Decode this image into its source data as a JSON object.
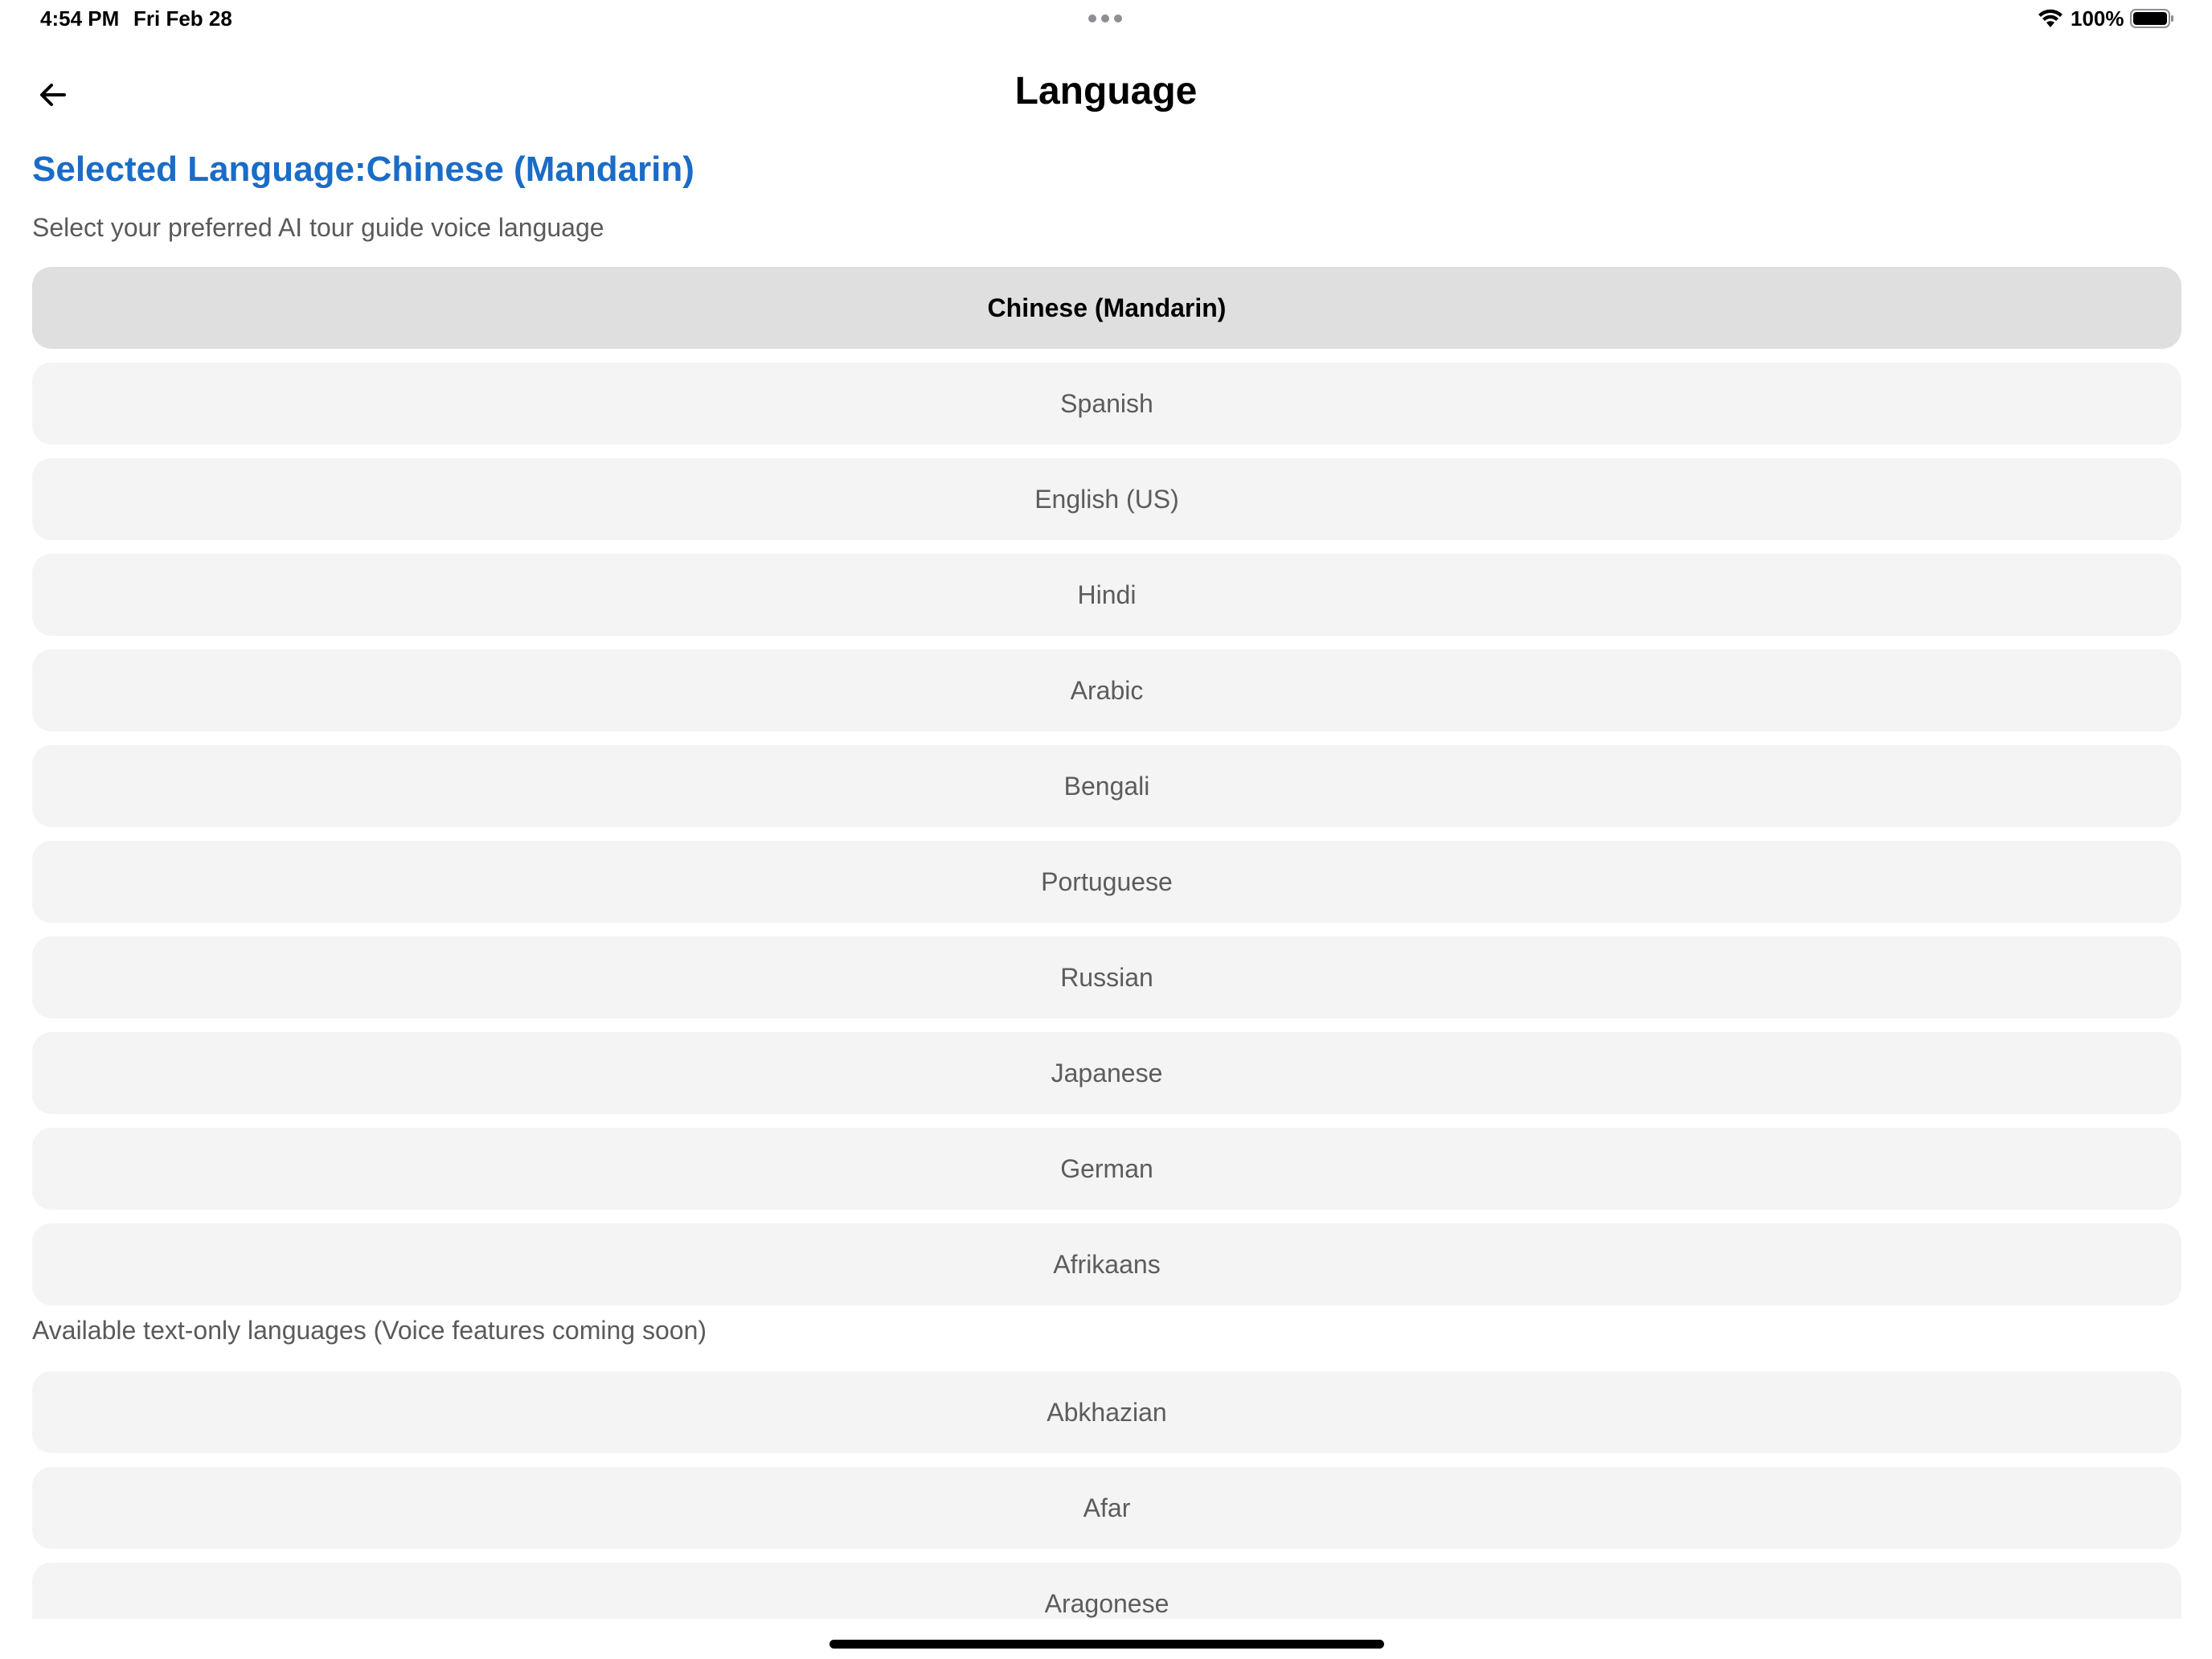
{
  "status_bar": {
    "time": "4:54 PM",
    "date": "Fri Feb 28",
    "battery": "100%"
  },
  "header": {
    "title": "Language",
    "back_icon": "arrow-left-icon"
  },
  "selected_heading": "Selected Language:Chinese (Mandarin)",
  "subtitle": "Select your preferred AI tour guide voice language",
  "voice_languages": [
    {
      "label": "Chinese (Mandarin)",
      "selected": true
    },
    {
      "label": "Spanish"
    },
    {
      "label": "English (US)"
    },
    {
      "label": "Hindi"
    },
    {
      "label": "Arabic"
    },
    {
      "label": "Bengali"
    },
    {
      "label": "Portuguese"
    },
    {
      "label": "Russian"
    },
    {
      "label": "Japanese"
    },
    {
      "label": "German"
    },
    {
      "label": "Afrikaans"
    }
  ],
  "text_only_label": "Available text-only languages (Voice features coming soon)",
  "text_only_languages": [
    {
      "label": "Abkhazian"
    },
    {
      "label": "Afar"
    },
    {
      "label": "Aragonese"
    }
  ],
  "colors": {
    "accent": "#1a6cc7",
    "item_bg": "#f4f4f4",
    "selected_bg": "#dfdfdf"
  }
}
